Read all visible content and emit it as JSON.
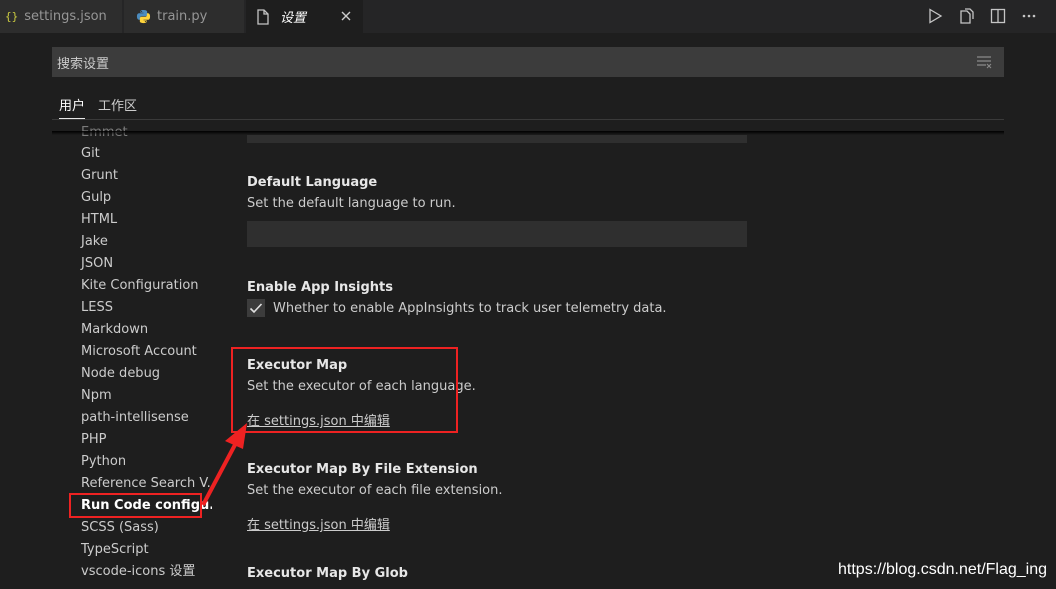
{
  "tabs": [
    {
      "label": "settings.json",
      "icon": "json-icon",
      "active": false
    },
    {
      "label": "train.py",
      "icon": "python-icon",
      "active": false
    },
    {
      "label": "设置",
      "icon": "settings-file-icon",
      "active": true
    }
  ],
  "toolbar": {
    "actions": [
      "run-icon",
      "open-changes-icon",
      "split-editor-icon",
      "more-icon"
    ]
  },
  "search": {
    "placeholder": "搜索设置"
  },
  "scope_tabs": [
    {
      "label": "用户",
      "active": true
    },
    {
      "label": "工作区",
      "active": false
    }
  ],
  "toc": {
    "items": [
      "Emmet",
      "Git",
      "Grunt",
      "Gulp",
      "HTML",
      "Jake",
      "JSON",
      "Kite Configuration",
      "LESS",
      "Markdown",
      "Microsoft Account",
      "Node debug",
      "Npm",
      "path-intellisense",
      "PHP",
      "Python",
      "Reference Search V...",
      "Run Code configu...",
      "SCSS (Sass)",
      "TypeScript",
      "vscode-icons 设置"
    ],
    "selected": "Run Code configu..."
  },
  "settings": {
    "default_language": {
      "title": "Default Language",
      "description": "Set the default language to run.",
      "value": ""
    },
    "enable_app_insights": {
      "title": "Enable App Insights",
      "description": "Whether to enable AppInsights to track user telemetry data.",
      "checked": true
    },
    "executor_map": {
      "title": "Executor Map",
      "description": "Set the executor of each language.",
      "link": "在 settings.json 中编辑"
    },
    "executor_map_by_ext": {
      "title": "Executor Map By File Extension",
      "description": "Set the executor of each file extension.",
      "link": "在 settings.json 中编辑"
    },
    "executor_map_by_glob": {
      "title": "Executor Map By Glob"
    }
  },
  "watermark": "https://blog.csdn.net/Flag_ing",
  "colors": {
    "background": "#1e1e1e",
    "annotation": "#ee2222"
  }
}
